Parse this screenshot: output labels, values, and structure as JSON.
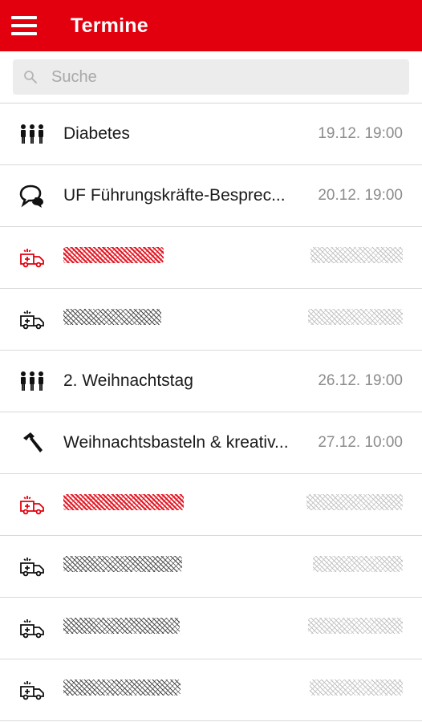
{
  "header": {
    "title": "Termine"
  },
  "search": {
    "placeholder": "Suche"
  },
  "colors": {
    "accent": "#e2000f",
    "date_text": "#8c8c8c"
  },
  "events": [
    {
      "icon": "group-icon",
      "name": "Diabetes",
      "date": "19.12. 19:00",
      "redacted": false
    },
    {
      "icon": "chat-bubbles-icon",
      "name": "UF Führungskräfte-Besprec...",
      "date": "20.12. 19:00",
      "redacted": false
    },
    {
      "icon": "ambulance-icon",
      "name": "",
      "date": "",
      "redacted": true,
      "color": "red"
    },
    {
      "icon": "ambulance-icon",
      "name": "",
      "date": "",
      "redacted": true,
      "color": "dark"
    },
    {
      "icon": "group-icon",
      "name": "2. Weihnachtstag",
      "date": "26.12. 19:00",
      "redacted": false
    },
    {
      "icon": "hammer-icon",
      "name": "Weihnachtsbasteln & kreativ...",
      "date": "27.12. 10:00",
      "redacted": false
    },
    {
      "icon": "ambulance-icon",
      "name": "",
      "date": "",
      "redacted": true,
      "color": "red"
    },
    {
      "icon": "ambulance-icon",
      "name": "",
      "date": "",
      "redacted": true,
      "color": "dark"
    },
    {
      "icon": "ambulance-icon",
      "name": "",
      "date": "",
      "redacted": true,
      "color": "dark"
    },
    {
      "icon": "ambulance-icon",
      "name": "",
      "date": "",
      "redacted": true,
      "color": "dark"
    }
  ]
}
